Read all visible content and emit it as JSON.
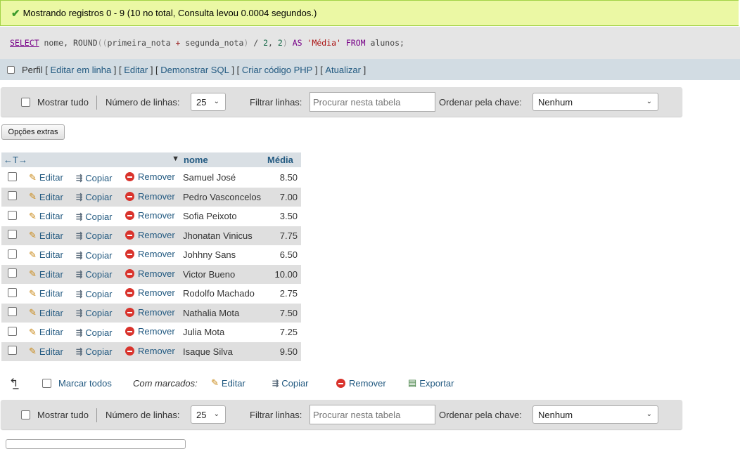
{
  "message": {
    "text": "Mostrando registros 0 - 9 (10 no total, Consulta levou 0.0004 segundos.)"
  },
  "sql": {
    "t1": "SELECT",
    "t2": " nome, ROUND",
    "t3": "((",
    "t4": "primeira_nota ",
    "t5": "+",
    "t6": " segunda_nota",
    "t7": ")",
    "t8": " / ",
    "t9": "2",
    "t10": ", ",
    "t11": "2",
    "t12": ")",
    "t13": " AS ",
    "t14": "'Média'",
    "t15": " FROM",
    "t16": " alunos;"
  },
  "links": {
    "profile": "Perfil",
    "edit_inline": "Editar em linha",
    "edit": "Editar",
    "explain": "Demonstrar SQL",
    "php": "Criar código PHP",
    "refresh": "Atualizar"
  },
  "nav": {
    "show_all": "Mostrar tudo",
    "rows_label": "Número de linhas:",
    "rows_value": "25",
    "filter_label": "Filtrar linhas:",
    "filter_placeholder": "Procurar nesta tabela",
    "sort_label": "Ordenar pela chave:",
    "sort_value": "Nenhum"
  },
  "extra_options": "Opções extras",
  "table": {
    "col_name": "nome",
    "col_avg": "Média",
    "edit": "Editar",
    "copy": "Copiar",
    "delete": "Remover",
    "rows": [
      {
        "nome": "Samuel José",
        "media": "8.50"
      },
      {
        "nome": "Pedro Vasconcelos",
        "media": "7.00"
      },
      {
        "nome": "Sofia Peixoto",
        "media": "3.50"
      },
      {
        "nome": "Jhonatan Vinicus",
        "media": "7.75"
      },
      {
        "nome": "Johhny Sans",
        "media": "6.50"
      },
      {
        "nome": "Victor Bueno",
        "media": "10.00"
      },
      {
        "nome": "Rodolfo Machado",
        "media": "2.75"
      },
      {
        "nome": "Nathalia Mota",
        "media": "7.50"
      },
      {
        "nome": "Julia Mota",
        "media": "7.25"
      },
      {
        "nome": "Isaque Silva",
        "media": "9.50"
      }
    ]
  },
  "bulk": {
    "check_all": "Marcar todos",
    "with_selected": "Com marcados:",
    "edit": "Editar",
    "copy": "Copiar",
    "delete": "Remover",
    "export": "Exportar"
  }
}
